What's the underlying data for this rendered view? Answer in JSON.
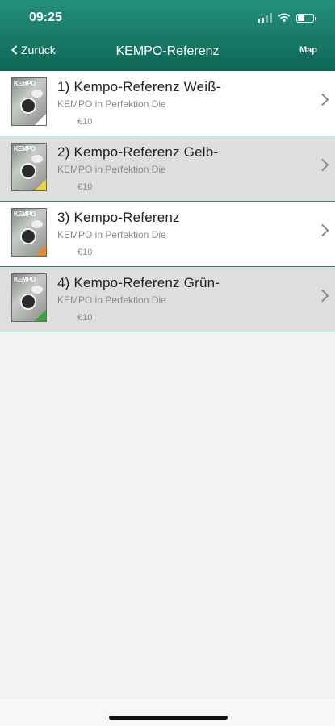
{
  "status_bar": {
    "time": "09:25"
  },
  "nav": {
    "back_label": "Zurück",
    "title": "KEMPO-Referenz",
    "map_label": "Map"
  },
  "items": [
    {
      "title": "1) Kempo-Referenz Weiß-",
      "subtitle": "KEMPO in Perfektion Die",
      "price": "€10",
      "thumb_text": "KEMPO",
      "belt_color": "#ffffff",
      "bg": "odd"
    },
    {
      "title": "2) Kempo-Referenz Gelb-",
      "subtitle": "KEMPO in Perfektion Die",
      "price": "€10",
      "thumb_text": "KEMPO",
      "belt_color": "#e8d63a",
      "bg": "even"
    },
    {
      "title": "3) Kempo-Referenz",
      "subtitle": "KEMPO in Perfektion Die",
      "price": "€10",
      "thumb_text": "KEMPO",
      "belt_color": "#e88a2a",
      "bg": "odd"
    },
    {
      "title": "4) Kempo-Referenz Grün-",
      "subtitle": "KEMPO in Perfektion Die",
      "price": "€10",
      "thumb_text": "KEMPO",
      "belt_color": "#3aa63a",
      "bg": "even"
    }
  ],
  "colors": {
    "header_top": "#23907c",
    "header_bottom": "#0f6656",
    "separator": "#2a8a78"
  }
}
